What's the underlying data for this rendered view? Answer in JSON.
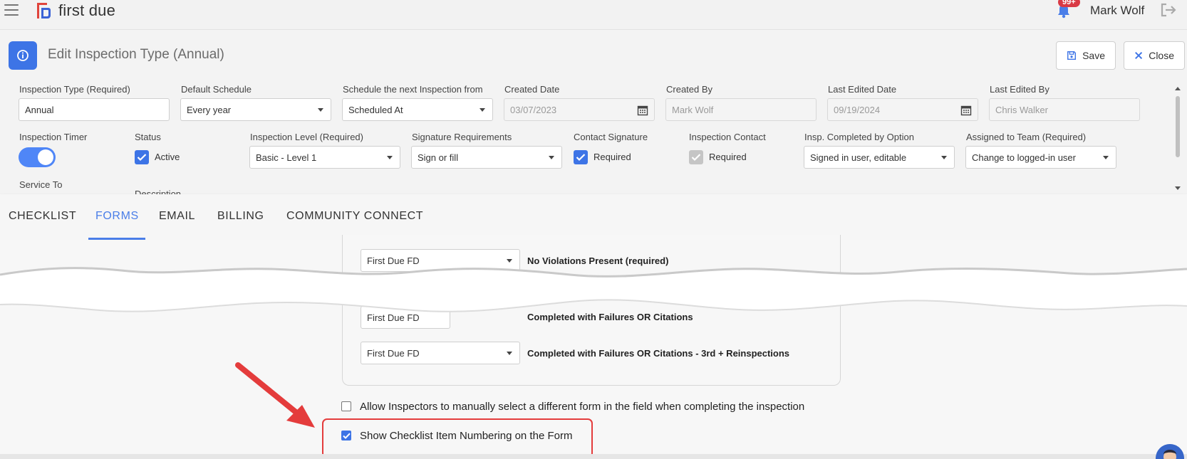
{
  "topbar": {
    "logo_text": "first due",
    "notification_badge": "99+",
    "user_name": "Mark Wolf"
  },
  "header": {
    "title": "Edit Inspection Type (Annual)",
    "save_label": "Save",
    "close_label": "Close"
  },
  "fields": {
    "inspection_type": {
      "label": "Inspection Type (Required)",
      "value": "Annual"
    },
    "default_schedule": {
      "label": "Default Schedule",
      "value": "Every year"
    },
    "schedule_next_from": {
      "label": "Schedule the next Inspection from",
      "value": "Scheduled At"
    },
    "created_date": {
      "label": "Created Date",
      "value": "03/07/2023"
    },
    "created_by": {
      "label": "Created By",
      "value": "Mark Wolf"
    },
    "last_edited_date": {
      "label": "Last Edited Date",
      "value": "09/19/2024"
    },
    "last_edited_by": {
      "label": "Last Edited By",
      "value": "Chris Walker"
    },
    "inspection_timer": {
      "label": "Inspection Timer",
      "on": true
    },
    "status": {
      "label": "Status",
      "checkbox_label": "Active",
      "checked": true
    },
    "inspection_level": {
      "label": "Inspection Level (Required)",
      "value": "Basic - Level 1"
    },
    "signature_requirements": {
      "label": "Signature Requirements",
      "value": "Sign or fill"
    },
    "contact_signature": {
      "label": "Contact Signature",
      "checkbox_label": "Required",
      "checked": true
    },
    "inspection_contact": {
      "label": "Inspection Contact",
      "checkbox_label": "Required",
      "checked": true
    },
    "insp_completed_by": {
      "label": "Insp. Completed by Option",
      "value": "Signed in user, editable"
    },
    "assigned_to_team": {
      "label": "Assigned to Team (Required)",
      "value": "Change to logged-in user"
    },
    "service_to": {
      "label": "Service To"
    },
    "description_partial": {
      "label": "Description"
    }
  },
  "tabs": [
    {
      "label": "CHECKLIST"
    },
    {
      "label": "FORMS"
    },
    {
      "label": "EMAIL"
    },
    {
      "label": "BILLING"
    },
    {
      "label": "COMMUNITY CONNECT"
    }
  ],
  "forms": {
    "rows": [
      {
        "select_value": "First Due FD",
        "label": "No Violations Present (required)"
      },
      {
        "select_value": "First Due FD",
        "label": "Completed with Failures OR Citations"
      },
      {
        "select_value": "First Due FD",
        "label": "Completed with Failures OR Citations - 3rd + Reinspections"
      }
    ],
    "allow_manual_select": {
      "label": "Allow Inspectors to manually select a different form in the field when completing the inspection",
      "checked": false
    },
    "show_numbering": {
      "label": "Show Checklist Item Numbering on the Form",
      "checked": true
    }
  },
  "colors": {
    "accent": "#3d74e6",
    "annotation_red": "#e43c3c",
    "badge_red": "#d93a45"
  }
}
